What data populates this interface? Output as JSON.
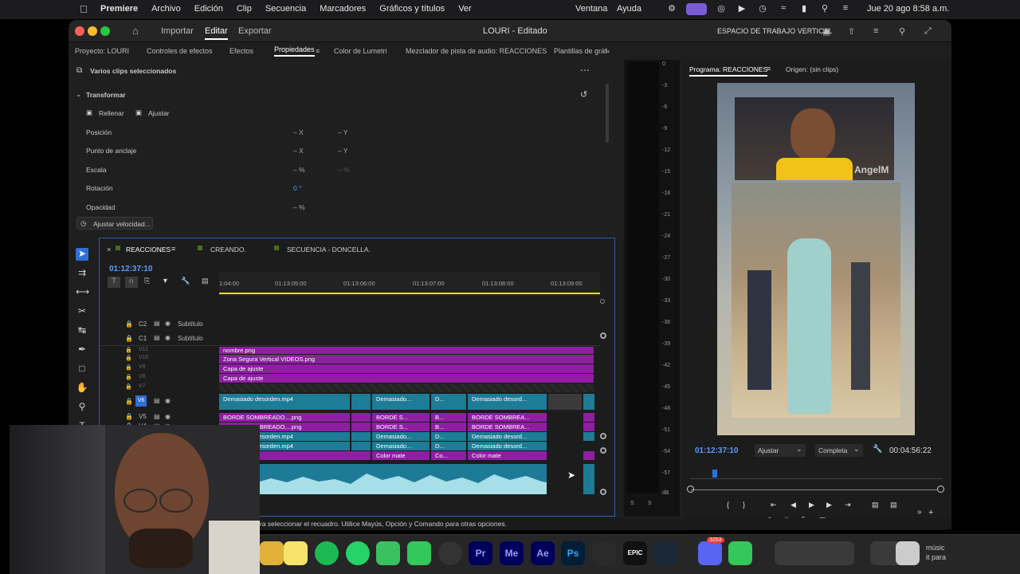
{
  "menubar": {
    "app": "Premiere",
    "items": [
      "Archivo",
      "Edición",
      "Clip",
      "Secuencia",
      "Marcadores",
      "Gráficos y títulos",
      "Ver"
    ],
    "right_items": [
      "Ventana",
      "Ayuda"
    ],
    "datetime": "Jue 20 ago 8:58 a.m."
  },
  "titlebar": {
    "nav": [
      "Importar",
      "Editar",
      "Exportar"
    ],
    "active_nav": "Editar",
    "project_title": "LOURI - Editado",
    "workspace": "ESPACIO DE TRABAJO  VERTICAL"
  },
  "panel_tabs": {
    "items": [
      "Proyecto: LOURI",
      "Controles de efectos",
      "Efectos",
      "Propiedades",
      "Color de Lumetri",
      "Mezclador de pista de audio: REACCIONES",
      "Plantillas de gráf"
    ],
    "active": "Propiedades"
  },
  "properties": {
    "selection_label": "Varios clips seleccionados",
    "section": "Transformar",
    "fill_button": "Rellenar",
    "fit_button": "Ajustar",
    "rows": [
      {
        "label": "Posición",
        "v1": "– X",
        "v2": "– Y"
      },
      {
        "label": "Punto de anclaje",
        "v1": "– X",
        "v2": "– Y"
      },
      {
        "label": "Escala",
        "v1": "– %",
        "v2": "– %"
      },
      {
        "label": "Rotación",
        "v1": "0 °",
        "v2": ""
      },
      {
        "label": "Opacidad",
        "v1": "– %",
        "v2": ""
      }
    ],
    "speed_button": "Ajustar velocidad..."
  },
  "timeline": {
    "tabs": [
      "REACCIONES",
      "CREANDO.",
      "SECUENCIA - DONCELLA."
    ],
    "timecode": "01:12:37:10",
    "ruler": [
      "1:04:00",
      "01:13:05:00",
      "01:13:06:00",
      "01:13:07:00",
      "01:13:08:00",
      "01:13:09:00"
    ],
    "caption_tracks": [
      {
        "id": "C2",
        "label": "Subtítulo"
      },
      {
        "id": "C1",
        "label": "Subtítulo"
      }
    ],
    "video_tracks": [
      {
        "id": "V11",
        "clips": [
          {
            "label": "nombre.png"
          }
        ]
      },
      {
        "id": "V10",
        "clips": [
          {
            "label": "Zona Segura Vertical VIDEOS.png"
          }
        ]
      },
      {
        "id": "V9",
        "clips": [
          {
            "label": "Capa de ajuste"
          }
        ]
      },
      {
        "id": "V8",
        "clips": [
          {
            "label": "Capa de ajuste"
          }
        ]
      },
      {
        "id": "V7",
        "clips": []
      },
      {
        "id": "V6",
        "clips": [
          {
            "label": "Demasiado desorden.mp4"
          },
          {
            "label": "Demasiado..."
          },
          {
            "label": "D..."
          },
          {
            "label": "Demasiado desord..."
          }
        ]
      },
      {
        "id": "V5",
        "clips": [
          {
            "label": "BORDE SOMBREADO....png"
          },
          {
            "label": "BORDE S..."
          },
          {
            "label": "B..."
          },
          {
            "label": "BORDE SOMBREA..."
          }
        ]
      },
      {
        "id": "V4",
        "clips": [
          {
            "label": "BORDE SOMBREADO....png"
          },
          {
            "label": "BORDE S..."
          },
          {
            "label": "B..."
          },
          {
            "label": "BORDE SOMBREA..."
          }
        ]
      },
      {
        "id": "V3",
        "clips": [
          {
            "label": "Demasiado desorden.mp4"
          },
          {
            "label": "Demasiado..."
          },
          {
            "label": "D..."
          },
          {
            "label": "Demasiado desord..."
          }
        ]
      },
      {
        "id": "V2",
        "clips": [
          {
            "label": "Demasiado desorden.mp4"
          },
          {
            "label": "Demasiado..."
          },
          {
            "label": "D..."
          },
          {
            "label": "Demasiado desord..."
          }
        ]
      },
      {
        "id": "V1",
        "clips": [
          {
            "label": "Color mate"
          },
          {
            "label": "Co..."
          },
          {
            "label": "Color mate"
          }
        ]
      }
    ],
    "fx": "fx"
  },
  "meter": {
    "ticks": [
      "0",
      "-3",
      "-6",
      "-9",
      "-12",
      "-15",
      "-18",
      "-21",
      "-24",
      "-27",
      "-30",
      "-33",
      "-36",
      "-39",
      "-42",
      "-45",
      "-48",
      "-51",
      "-54",
      "-57",
      "dB"
    ],
    "bottom": [
      "S",
      "S"
    ]
  },
  "program": {
    "title": "Programa: REACCIONES",
    "source": "Origen: (sin clips)",
    "timecode": "01:12:37:10",
    "fit": "Ajustar",
    "quality": "Completa",
    "duration": "00:04:56:22",
    "watermark": "AngelM"
  },
  "status": {
    "text": "ra seleccionar el recuadro. Utilice Mayús, Opción y Comando para otras opciones."
  },
  "dock": {
    "apps": [
      "Pr",
      "Me",
      "Ae",
      "Ps",
      "EPIC"
    ],
    "badge": "3253",
    "notification": "músic\nit para"
  },
  "colors": {
    "accent_blue": "#2f6fd6",
    "clip_purple": "#8f1ea3",
    "clip_teal": "#1d7c97",
    "playhead": "#e6e600"
  }
}
